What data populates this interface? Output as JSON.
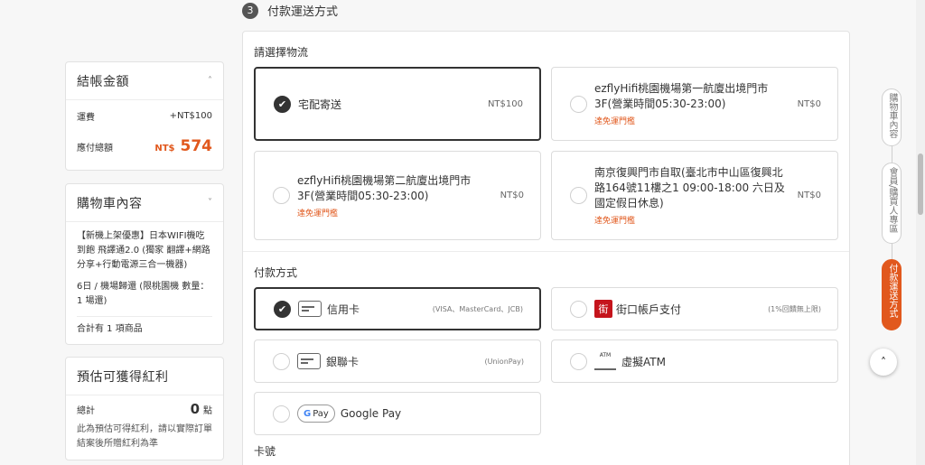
{
  "step": {
    "num": "3",
    "title": "付款運送方式"
  },
  "checkout": {
    "title": "結帳金額",
    "shipping_label": "運費",
    "shipping_value": "+NT$100",
    "total_label": "應付總額",
    "total_currency": "NT$",
    "total_amount": "574"
  },
  "cart": {
    "title": "購物車內容",
    "product_name": "【新機上架優惠】日本WIFI機吃到飽 飛譯通2.0 (獨家 翻譯+網路分享+行動電源三合一機器)",
    "product_spec": "6日 / 機場歸還 (限桃園機 數量：1 場還)",
    "count_text": "合計有 1 項商品"
  },
  "points": {
    "title": "預估可獲得紅利",
    "total_label": "總計",
    "value": "0",
    "unit": "點",
    "note": "此為預估可得紅利，請以實際訂單結案後所贈紅利為準"
  },
  "shipping": {
    "label": "請選擇物流",
    "options": [
      {
        "name": "宅配寄送",
        "price": "NT$100"
      },
      {
        "name": "ezflyHifi桃園機場第一航廈出境門市3F(營業時間05:30-23:00)",
        "note": "達免運門檻",
        "price": "NT$0"
      },
      {
        "name": "ezflyHifi桃園機場第二航廈出境門市3F(營業時間05:30-23:00)",
        "note": "達免運門檻",
        "price": "NT$0"
      },
      {
        "name": "南京復興門市自取(臺北市中山區復興北路164號11樓之1 09:00-18:00 六日及國定假日休息)",
        "note": "達免運門檻",
        "price": "NT$0"
      }
    ]
  },
  "payment": {
    "label": "付款方式",
    "options": [
      {
        "name": "信用卡",
        "note": "(VISA、MasterCard、JCB)"
      },
      {
        "name": "街口帳戶支付",
        "note": "(1%回饋無上限)",
        "icon_text": "街"
      },
      {
        "name": "銀聯卡",
        "note": "(UnionPay)"
      },
      {
        "name": "虛擬ATM",
        "icon_text": "ATM"
      },
      {
        "name": "Google Pay",
        "icon_text": "Pay"
      }
    ]
  },
  "card_no_label": "卡號",
  "side_nav": [
    {
      "label": "購物車內容"
    },
    {
      "label": "會員/購買人專區"
    },
    {
      "label": "付款運送方式"
    }
  ],
  "icons": {
    "check": "check-icon",
    "chevron": "chevron-up-icon",
    "scroll_top": "arrow-up-icon"
  },
  "colors": {
    "accent": "#e1581d",
    "dark": "#333333"
  }
}
